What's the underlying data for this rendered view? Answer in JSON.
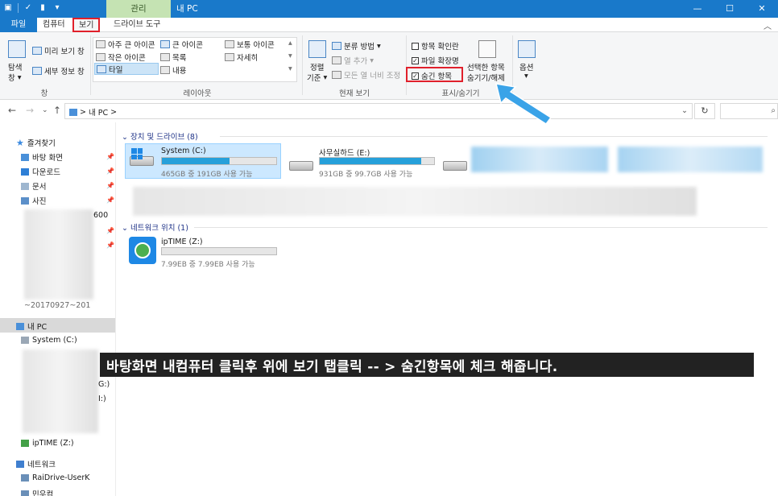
{
  "titlebar": {
    "context_tab": "관리",
    "window_title": "내 PC",
    "qat_icons": [
      "folder-icon",
      "properties-icon",
      "new-folder-icon",
      "dropdown-icon"
    ]
  },
  "tabs": {
    "file": "파일",
    "computer": "컴퓨터",
    "view": "보기",
    "drive_tools": "드라이브 도구"
  },
  "ribbon": {
    "pane": {
      "nav_pane_line1": "탐색",
      "nav_pane_line2": "창",
      "preview_pane": "미리 보기 창",
      "details_pane": "세부 정보 창",
      "label": "창"
    },
    "layout": {
      "items": [
        "아주 큰 아이콘",
        "큰 아이콘",
        "보통 아이콘",
        "작은 아이콘",
        "목록",
        "자세히",
        "타일",
        "내용"
      ],
      "selected": "타일",
      "label": "레이아웃"
    },
    "current_view": {
      "sort_line1": "정렬",
      "sort_line2": "기준",
      "group_by": "분류 방법",
      "add_columns": "열 추가",
      "fit_columns": "모든 열 너비 조정",
      "label": "현재 보기"
    },
    "show_hide": {
      "item_checkboxes": "항목 확인란",
      "file_extensions": "파일 확장명",
      "hidden_items": "숨긴 항목",
      "item_checkboxes_checked": false,
      "file_extensions_checked": true,
      "hidden_items_checked": true,
      "hide_selected_line1": "선택한 항목",
      "hide_selected_line2": "숨기기/해제",
      "label": "표시/숨기기"
    },
    "options": "옵션"
  },
  "address": {
    "path": "내 PC",
    "separator": ">"
  },
  "nav": {
    "quick_access": "즐겨찾기",
    "quick_items": [
      "바탕 화면",
      "다운로드",
      "문서",
      "사진"
    ],
    "partial_text_1": "600",
    "partial_text_2": "~20170927~201",
    "this_pc": "내 PC",
    "system_drive": "System (C:)",
    "partial_text_3": "G:)",
    "partial_text_4": "I:)",
    "iptime": "ipTIME (Z:)",
    "network": "네트워크",
    "net_items": [
      "RaiDrive-UserK",
      "민우컴"
    ]
  },
  "content": {
    "devices_header": "장치 및 드라이브 (8)",
    "network_header": "네트워크 위치 (1)",
    "drives": [
      {
        "name": "System (C:)",
        "detail": "465GB 중 191GB 사용 가능",
        "used_fraction": 0.59
      },
      {
        "name": "사무실하드 (E:)",
        "detail": "931GB 중 99.7GB 사용 가능",
        "used_fraction": 0.89
      }
    ],
    "network_drive": {
      "name": "ipTIME (Z:)",
      "detail": "7.99EB 중 7.99EB 사용 가능",
      "used_fraction": 0.0
    }
  },
  "banner": "바탕화면 내컴퓨터 클릭후 위에 보기 탭클릭 -- > 숨긴항목에 체크 해줍니다.",
  "colors": {
    "accent": "#1979ca",
    "highlight_red": "#e0202b",
    "arrow_blue": "#3aa3e8",
    "bar_fill": "#26a0da"
  }
}
